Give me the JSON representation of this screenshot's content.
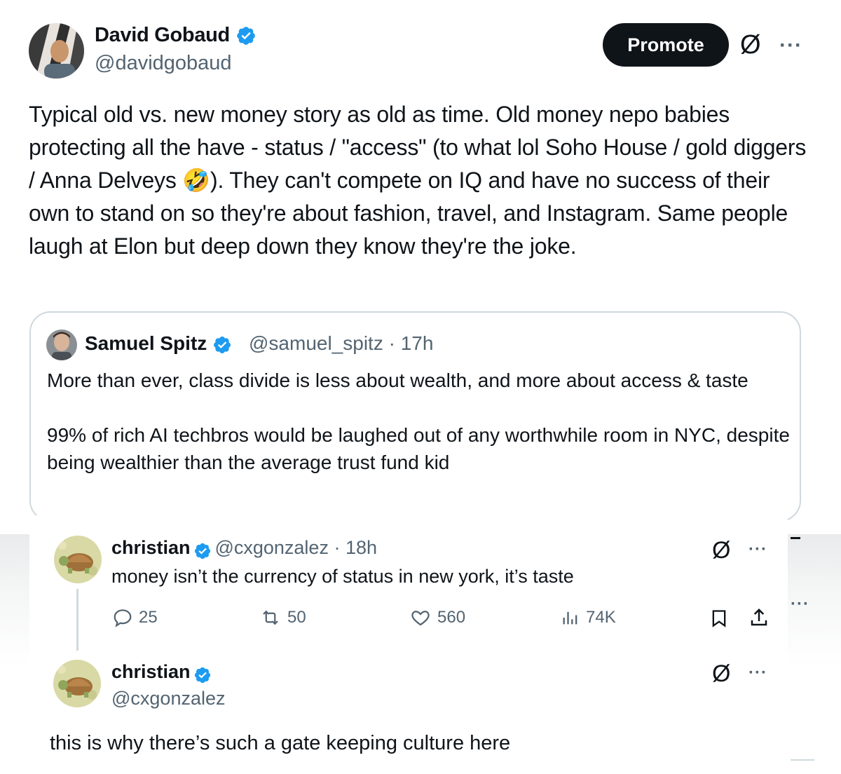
{
  "post": {
    "author_name": "David Gobaud",
    "author_handle": "@davidgobaud",
    "promote_label": "Promote",
    "body": "Typical old vs. new money story as old as time. Old money nepo babies protecting all the have - status / \"access\" (to what lol Soho House / gold diggers / Anna Delveys 🤣). They can't compete on IQ and have no success of their own to stand on so they're about fashion, travel, and Instagram. Same people laugh at Elon but deep down they know they're the joke."
  },
  "quote": {
    "author_name": "Samuel Spitz",
    "author_handle": "@samuel_spitz",
    "time": "17h",
    "paragraph1": "More than ever, class divide is less about wealth, and more about access & taste",
    "paragraph2": "99% of rich AI techbros would be laughed out of any worthwhile room in NYC, despite being wealthier than the average trust fund kid"
  },
  "reply1": {
    "author_name": "christian",
    "author_handle": "@cxgonzalez",
    "time": "18h",
    "text": "money isn’t the currency of status in new york, it’s taste",
    "stats": {
      "replies": "25",
      "reposts": "50",
      "likes": "560",
      "views": "74K"
    }
  },
  "reply2": {
    "author_name": "christian",
    "author_handle": "@cxgonzalez",
    "text": "this is why there’s such a gate keeping culture here"
  },
  "icons": {
    "verified": "verified-badge-icon",
    "grok": "grok-icon",
    "more": "more-icon",
    "reply": "reply-icon",
    "repost": "repost-icon",
    "like": "heart-icon",
    "views": "views-icon",
    "bookmark": "bookmark-icon",
    "share": "share-icon"
  },
  "colors": {
    "verified": "#1d9bf0",
    "text": "#0f1419",
    "secondary": "#536471",
    "border": "#cfd9de"
  }
}
